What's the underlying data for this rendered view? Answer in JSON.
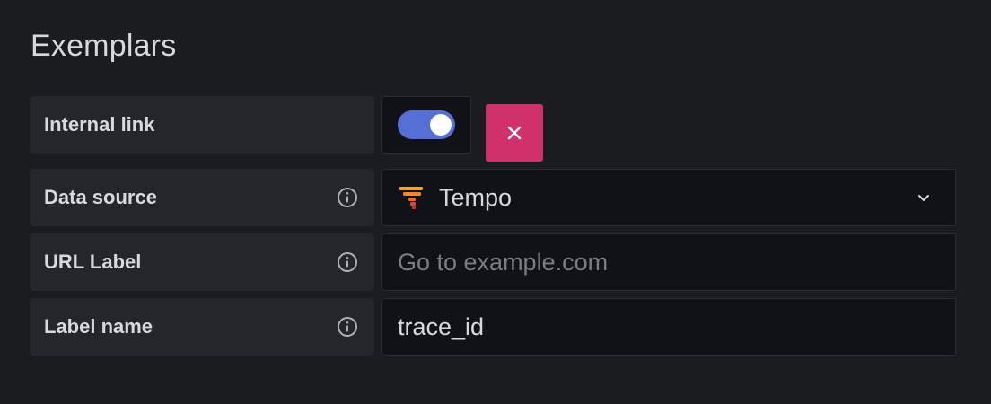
{
  "section": {
    "title": "Exemplars"
  },
  "internal_link": {
    "label": "Internal link",
    "enabled": true
  },
  "data_source": {
    "label": "Data source",
    "value": "Tempo",
    "icon": "tempo-logo-icon"
  },
  "url_label": {
    "label": "URL Label",
    "placeholder": "Go to example.com",
    "value": ""
  },
  "label_name": {
    "label": "Label name",
    "value": "trace_id"
  },
  "colors": {
    "accent": "#5470d6",
    "danger": "#d0316a",
    "background": "#1b1c20"
  }
}
